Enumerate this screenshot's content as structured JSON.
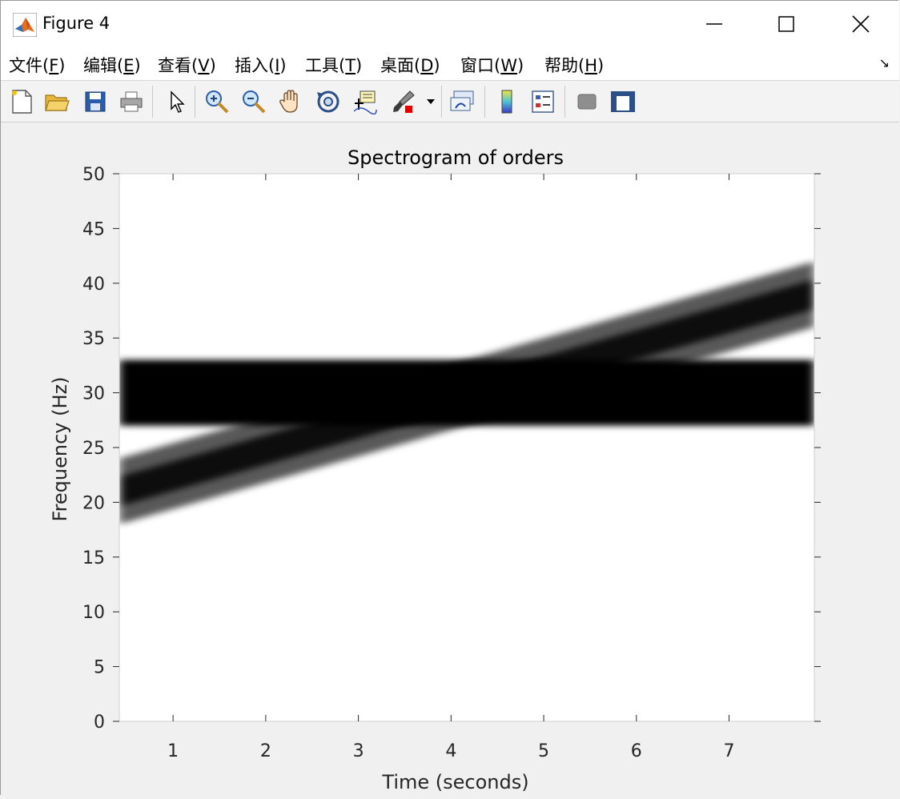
{
  "window": {
    "title": "Figure 4",
    "controls": {
      "minimize": "minimize",
      "maximize": "maximize",
      "close": "close"
    }
  },
  "menu": [
    {
      "label": "文件(",
      "key": "F",
      "close": ")"
    },
    {
      "label": "编辑(",
      "key": "E",
      "close": ")"
    },
    {
      "label": "查看(",
      "key": "V",
      "close": ")"
    },
    {
      "label": "插入(",
      "key": "I",
      "close": ")"
    },
    {
      "label": "工具(",
      "key": "T",
      "close": ")"
    },
    {
      "label": "桌面(",
      "key": "D",
      "close": ")"
    },
    {
      "label": "窗口(",
      "key": "W",
      "close": ")"
    },
    {
      "label": "帮助(",
      "key": "H",
      "close": ")"
    }
  ],
  "toolbar": [
    "new-figure-icon",
    "open-file-icon",
    "save-icon",
    "print-icon",
    "pointer-icon",
    "zoom-in-icon",
    "zoom-out-icon",
    "pan-icon",
    "rotate-3d-icon",
    "data-cursor-icon",
    "brush-icon",
    "brush-dropdown-icon",
    "link-plot-icon",
    "colorbar-icon",
    "legend-icon",
    "hide-plot-tools-icon",
    "show-plot-tools-icon"
  ],
  "chart_data": {
    "type": "heatmap",
    "title": "Spectrogram of orders",
    "xlabel": "Time (seconds)",
    "ylabel": "Frequency (Hz)",
    "xlim": [
      0.42,
      7.92
    ],
    "ylim": [
      0,
      50
    ],
    "xticks": [
      1,
      2,
      3,
      4,
      5,
      6,
      7
    ],
    "yticks": [
      0,
      5,
      10,
      15,
      20,
      25,
      30,
      35,
      40,
      45,
      50
    ],
    "colormap": "gray-inverted",
    "series": [
      {
        "x": [
          0.42,
          7.92
        ],
        "y": [
          30,
          30
        ],
        "intensity": 1.0
      },
      {
        "x": [
          0.42,
          7.92
        ],
        "y": [
          21,
          39
        ],
        "intensity": 0.65
      }
    ]
  }
}
